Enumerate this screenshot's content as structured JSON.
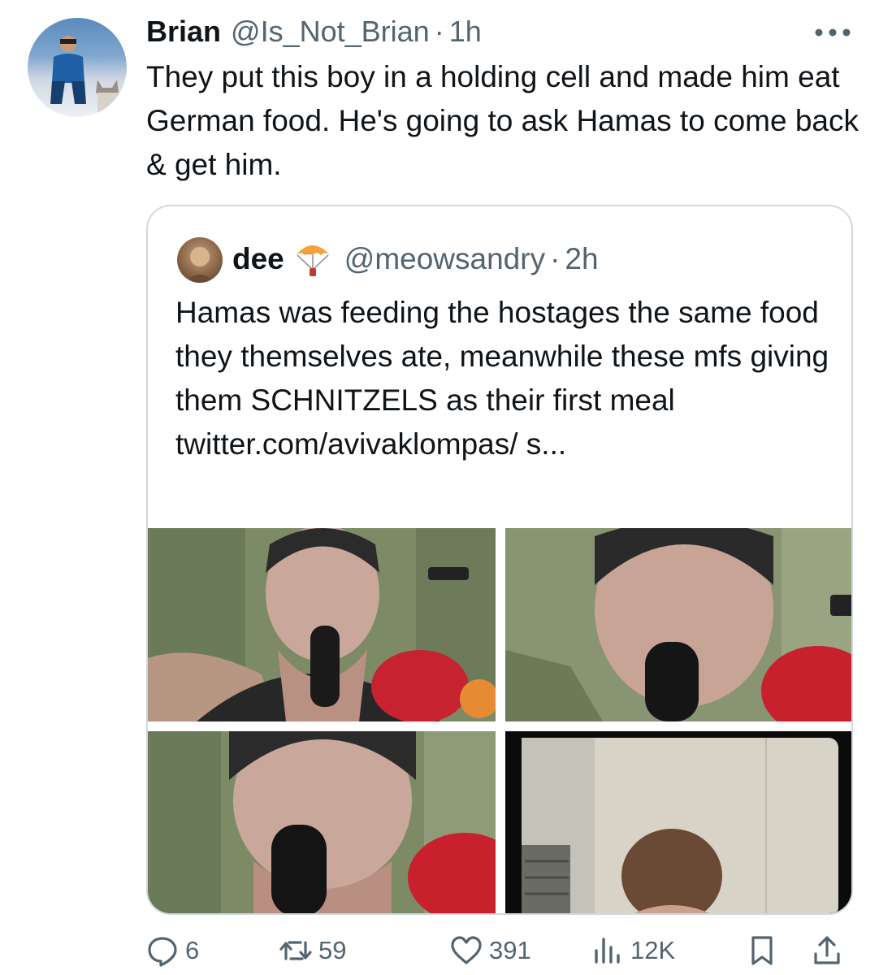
{
  "tweet": {
    "author_name": "Brian",
    "author_handle": "@Is_Not_Brian",
    "separator": "·",
    "time": "1h",
    "text": "They put this boy in a holding cell and made him eat German food. He's going to ask Hamas to come back & get him.",
    "avatar_icon": "user-avatar"
  },
  "quote": {
    "author_name": "dee",
    "author_badge_icon": "parachute-icon",
    "author_handle": "@meowsandry",
    "separator": "·",
    "time": "2h",
    "text": "Hamas was feeding the hostages the same food they themselves ate, meanwhile these mfs giving them SCHNITZELS as their first meal twitter.com/avivaklompas/ s...",
    "media_count": 4
  },
  "actions": {
    "replies": "6",
    "retweets": "59",
    "likes": "391",
    "views": "12K",
    "reply_icon": "reply-icon",
    "retweet_icon": "retweet-icon",
    "like_icon": "heart-icon",
    "views_icon": "views-chart-icon",
    "bookmark_icon": "bookmark-icon",
    "share_icon": "share-icon"
  },
  "colors": {
    "text_primary": "#0f1419",
    "text_secondary": "#536471",
    "border": "#cfd9de",
    "background": "#ffffff"
  }
}
